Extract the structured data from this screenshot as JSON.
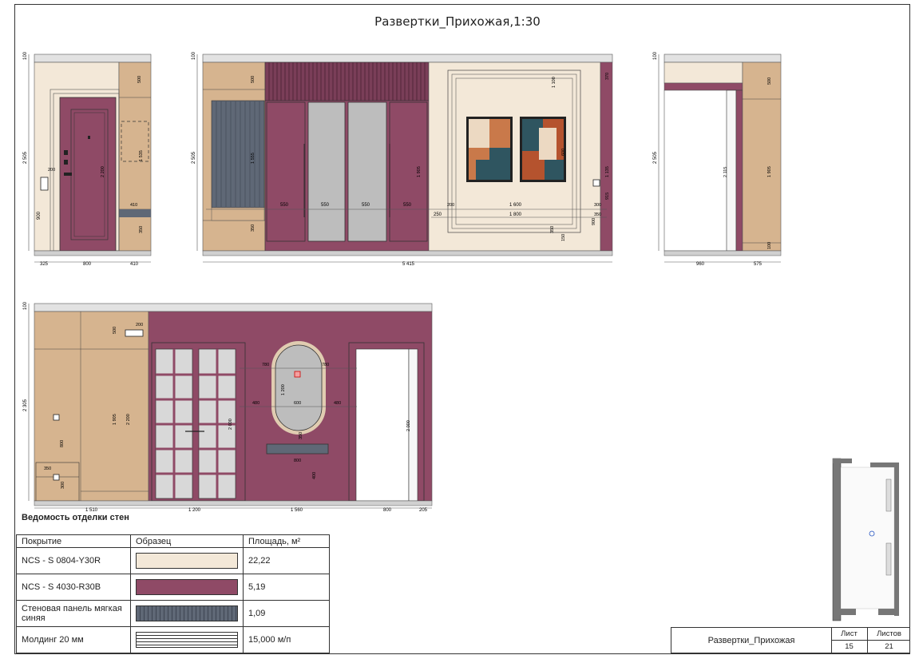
{
  "sheet_title": "Развертки_Прихожая,1:30",
  "colors": {
    "cream": "#f3e8d8",
    "berry": "#8f4a66",
    "berry_dark": "#7a3e58",
    "wood": "#d6b48f",
    "panel_blue": "#5f6876",
    "mirror": "#bdbdbd",
    "floor": "#d0d0d0"
  },
  "elevations": {
    "a": {
      "dims_v": [
        "100",
        "2 505",
        "900"
      ],
      "dims_h": [
        "325",
        "800",
        "410"
      ],
      "inner": [
        "500",
        "2 200",
        "1 535",
        "410",
        "350",
        "200"
      ]
    },
    "b": {
      "dims_v": [
        "100",
        "2 505"
      ],
      "dims_h": [
        "5 415"
      ],
      "inner": [
        "500",
        "1 555",
        "350",
        "550",
        "550",
        "550",
        "550",
        "1 905",
        "250",
        "200",
        "1 600",
        "1 800",
        "300",
        "350",
        "900",
        "370",
        "1 100",
        "600",
        "1 135",
        "350",
        "915",
        "150"
      ]
    },
    "c": {
      "dims_v": [
        "100",
        "2 505"
      ],
      "dims_h": [
        "960",
        "575"
      ],
      "inner": [
        "2 115",
        "500",
        "1 905",
        "100"
      ]
    },
    "d": {
      "dims_v": [
        "100",
        "2 305"
      ],
      "dims_h": [
        "1 510",
        "1 200",
        "1 560",
        "800",
        "205"
      ],
      "inner": [
        "200",
        "500",
        "1 905",
        "2 200",
        "800",
        "350",
        "300",
        "2 000",
        "780",
        "780",
        "1 200",
        "480",
        "600",
        "480",
        "350",
        "800",
        "400",
        "2 000"
      ]
    }
  },
  "finish_table": {
    "title": "Ведомость отделки стен",
    "headers": [
      "Покрытие",
      "Образец",
      "Площадь, м²"
    ],
    "rows": [
      {
        "name": "NCS - S 0804-Y30R",
        "area": "22,22",
        "swatch": "#f3e8d8"
      },
      {
        "name": "NCS - S 4030-R30B",
        "area": "5,19",
        "swatch": "#8f4a66"
      },
      {
        "name": "Стеновая панель мягкая синяя",
        "area": "1,09",
        "swatch": "#5f6876"
      },
      {
        "name": "Молдинг 20 мм",
        "area": "15,000 м/п",
        "swatch": "lines"
      }
    ]
  },
  "stamp": {
    "name": "Развертки_Прихожая",
    "sheet_label": "Лист",
    "sheets_label": "Листов",
    "sheet": "15",
    "sheets": "21"
  }
}
